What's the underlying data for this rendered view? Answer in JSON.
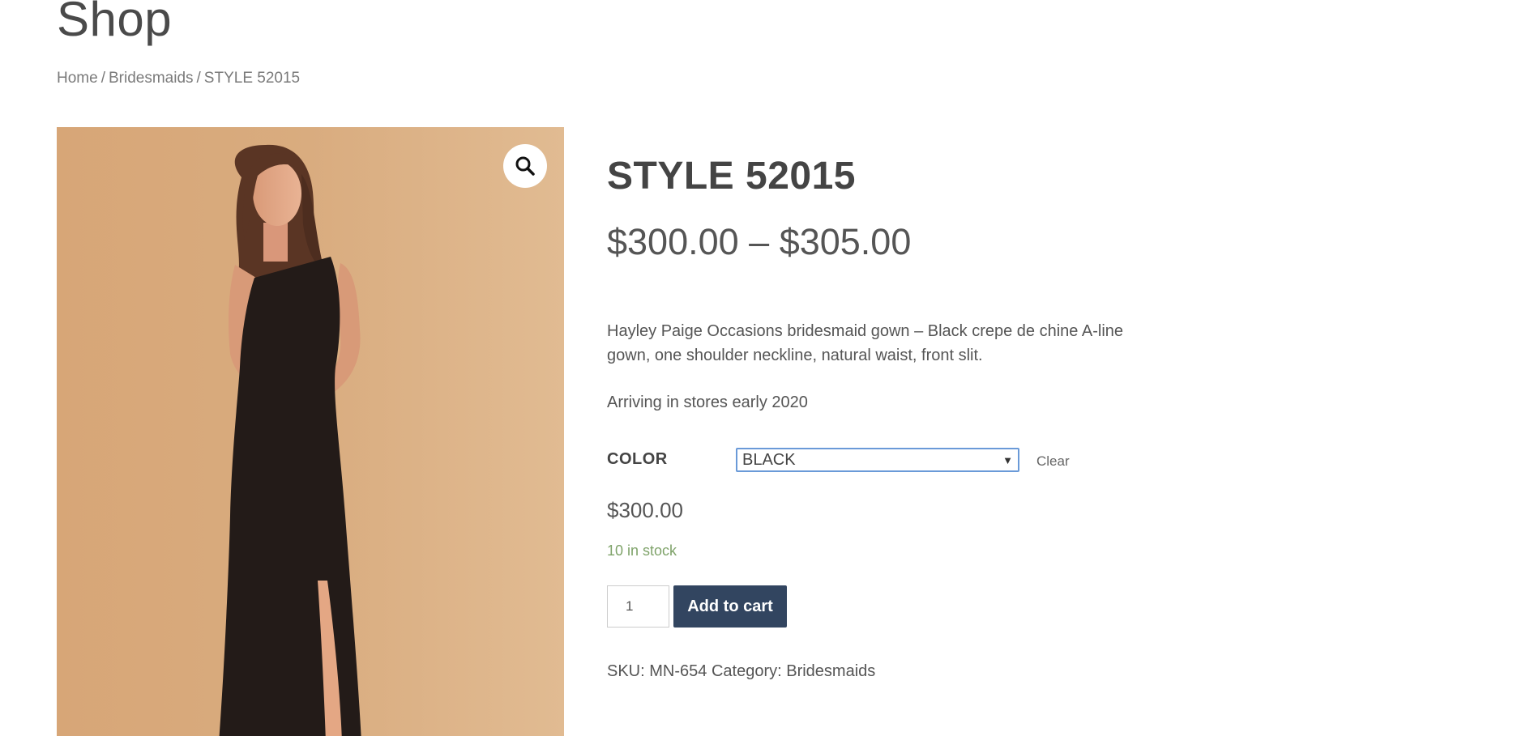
{
  "page": {
    "title": "Shop"
  },
  "breadcrumb": {
    "items": [
      "Home",
      "Bridesmaids",
      "STYLE 52015"
    ],
    "separator": "/"
  },
  "gallery": {
    "zoom_icon": "magnifier-icon",
    "image_background": "#d9ac7f"
  },
  "product": {
    "title": "STYLE 52015",
    "price_range": "$300.00 – $305.00",
    "description": "Hayley Paige Occasions bridesmaid gown – Black crepe de chine A-line gown, one shoulder neckline, natural waist, front slit.",
    "arriving": "Arriving in stores early 2020",
    "color_label": "COLOR",
    "color_selected": "BLACK",
    "clear_label": "Clear",
    "variation_price": "$300.00",
    "stock": "10 in stock",
    "quantity": "1",
    "add_to_cart": "Add to cart",
    "sku_label": "SKU:",
    "sku": "MN-654",
    "category_label": "Category:",
    "category": "Bridesmaids"
  },
  "colors": {
    "button_bg": "#324560",
    "stock_green": "#7fa36a",
    "select_border": "#6a9ad8"
  }
}
